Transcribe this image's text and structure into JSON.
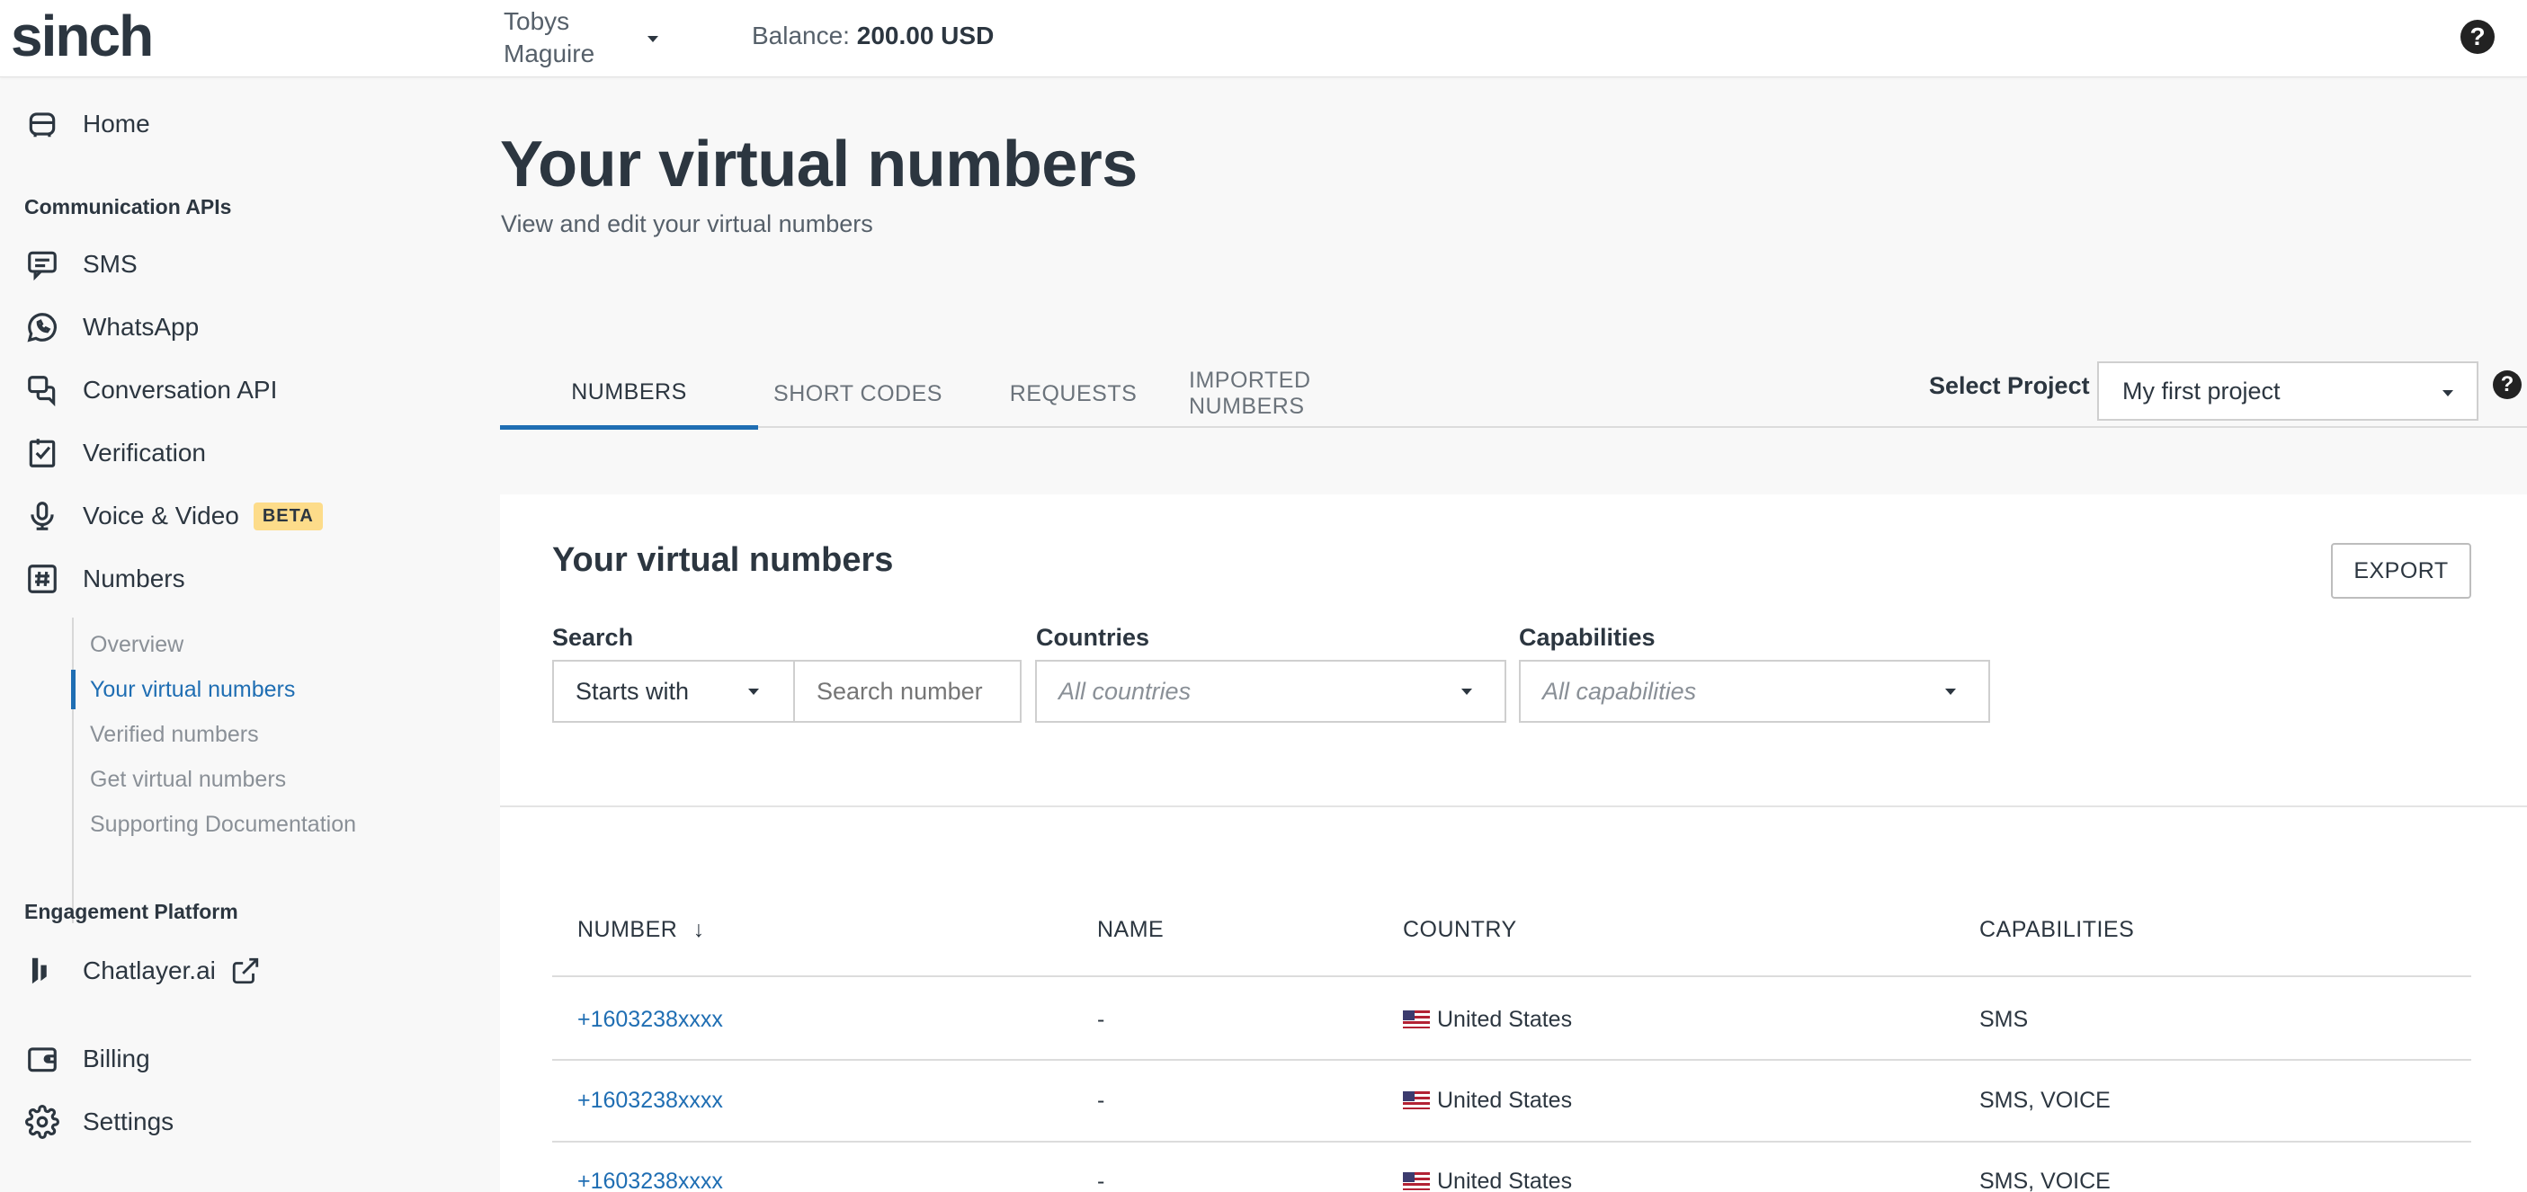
{
  "brand": {
    "logo": "sinch"
  },
  "header": {
    "user_name": "Tobys Maguire",
    "balance_label": "Balance:",
    "balance_value": "200.00 USD",
    "help_glyph": "?"
  },
  "sidebar": {
    "home": "Home",
    "section_communication": "Communication APIs",
    "items": [
      {
        "label": "SMS",
        "icon": "sms-icon"
      },
      {
        "label": "WhatsApp",
        "icon": "whatsapp-icon"
      },
      {
        "label": "Conversation API",
        "icon": "conversation-icon"
      },
      {
        "label": "Verification",
        "icon": "verification-icon"
      },
      {
        "label": "Voice & Video",
        "icon": "microphone-icon",
        "badge": "BETA"
      },
      {
        "label": "Numbers",
        "icon": "hashtag-icon"
      }
    ],
    "numbers_sub": [
      {
        "label": "Overview"
      },
      {
        "label": "Your virtual numbers",
        "active": true
      },
      {
        "label": "Verified numbers"
      },
      {
        "label": "Get virtual numbers"
      },
      {
        "label": "Supporting Documentation"
      }
    ],
    "section_engagement": "Engagement Platform",
    "chatlayer": "Chatlayer.ai",
    "billing": "Billing",
    "settings": "Settings"
  },
  "page": {
    "title": "Your virtual numbers",
    "subtitle": "View and edit your virtual numbers"
  },
  "tabs": [
    {
      "label": "NUMBERS",
      "active": true
    },
    {
      "label": "SHORT CODES"
    },
    {
      "label": "REQUESTS"
    },
    {
      "label": "IMPORTED NUMBERS"
    }
  ],
  "project": {
    "label": "Select Project",
    "selected": "My first project"
  },
  "card": {
    "title": "Your virtual numbers",
    "export_label": "EXPORT",
    "search_label": "Search",
    "search_mode": "Starts with",
    "search_placeholder": "Search number",
    "countries_label": "Countries",
    "countries_value": "All countries",
    "capabilities_label": "Capabilities",
    "capabilities_value": "All capabilities"
  },
  "table": {
    "columns": [
      "NUMBER",
      "NAME",
      "COUNTRY",
      "CAPABILITIES"
    ],
    "sort_glyph": "↓",
    "rows": [
      {
        "number": "+1603238xxxx",
        "name": "-",
        "country": "United States",
        "capabilities": "SMS"
      },
      {
        "number": "+1603238xxxx",
        "name": "-",
        "country": "United States",
        "capabilities": "SMS, VOICE"
      },
      {
        "number": "+1603238xxxx",
        "name": "-",
        "country": "United States",
        "capabilities": "SMS, VOICE"
      }
    ]
  },
  "colors": {
    "accent": "#1f6eb3",
    "beta_badge": "#fddc8a",
    "text": "#2c3640"
  }
}
